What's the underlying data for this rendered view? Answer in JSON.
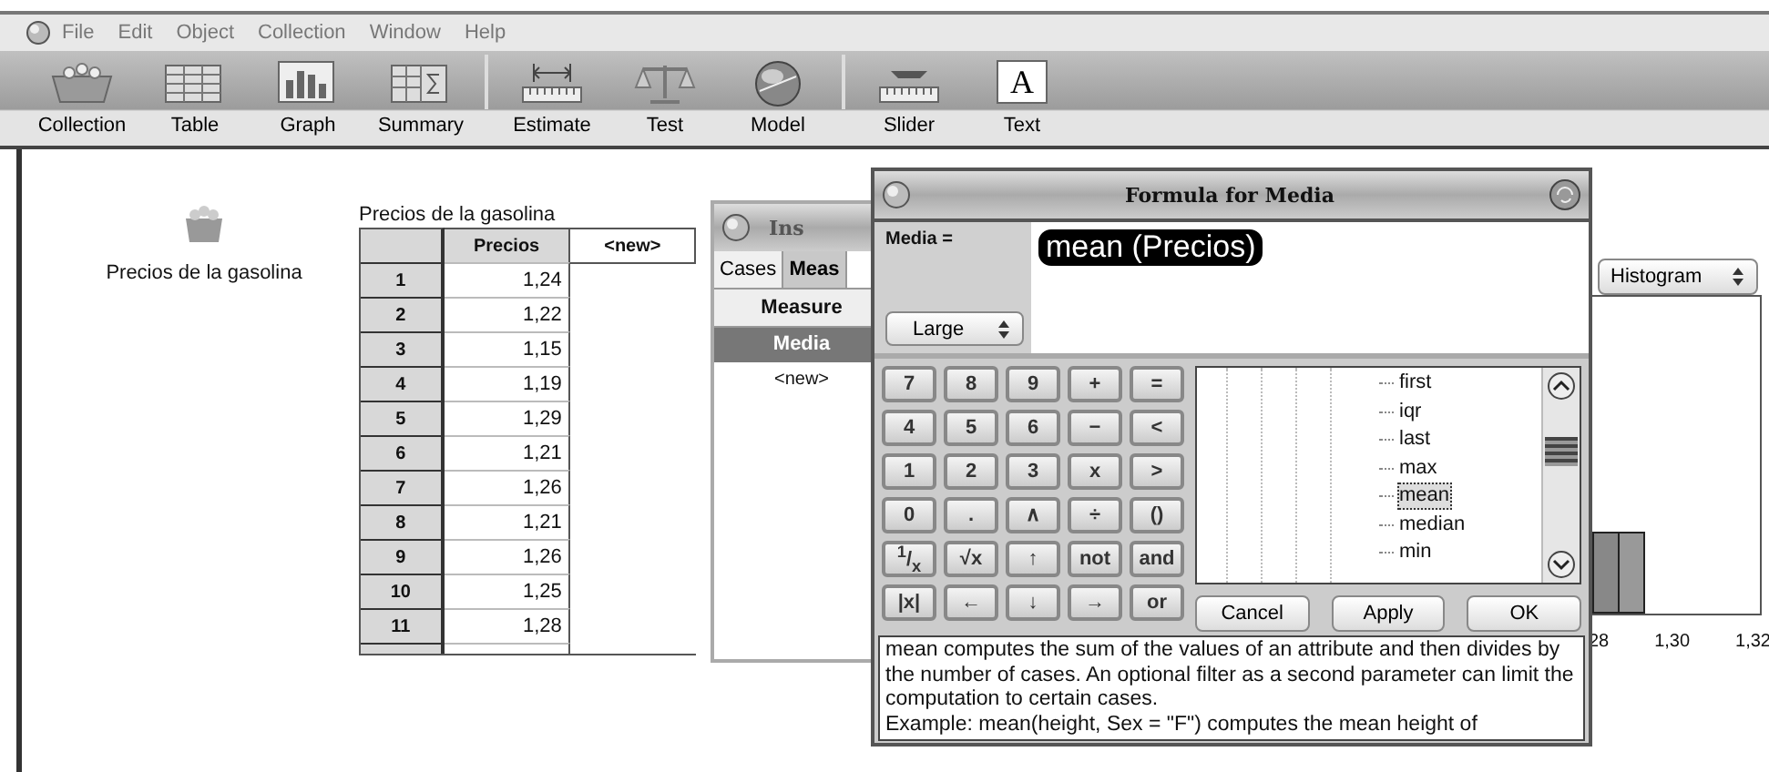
{
  "menu_bar": {
    "items": [
      "File",
      "Edit",
      "Object",
      "Collection",
      "Window",
      "Help"
    ]
  },
  "toolbar": {
    "tools": [
      {
        "label": "Collection",
        "kind": "collection"
      },
      {
        "label": "Table",
        "kind": "table"
      },
      {
        "label": "Graph",
        "kind": "graph"
      },
      {
        "label": "Summary",
        "kind": "summary",
        "separator_after": true
      },
      {
        "label": "Estimate",
        "kind": "estimate"
      },
      {
        "label": "Test",
        "kind": "test"
      },
      {
        "label": "Model",
        "kind": "model",
        "separator_after": true
      },
      {
        "label": "Slider",
        "kind": "slider"
      },
      {
        "label": "Text",
        "kind": "text",
        "glyph": "A"
      }
    ]
  },
  "collection": {
    "label": "Precios de la gasolina"
  },
  "table": {
    "title": "Precios de la gasolina",
    "columns": [
      "Precios",
      "<new>"
    ],
    "rows": [
      {
        "index": "1",
        "value": "1,24"
      },
      {
        "index": "2",
        "value": "1,22"
      },
      {
        "index": "3",
        "value": "1,15"
      },
      {
        "index": "4",
        "value": "1,19"
      },
      {
        "index": "5",
        "value": "1,29"
      },
      {
        "index": "6",
        "value": "1,21"
      },
      {
        "index": "7",
        "value": "1,26"
      },
      {
        "index": "8",
        "value": "1,21"
      },
      {
        "index": "9",
        "value": "1,26"
      },
      {
        "index": "10",
        "value": "1,25"
      },
      {
        "index": "11",
        "value": "1,28"
      }
    ]
  },
  "inspector": {
    "title": "Ins",
    "tabs": [
      {
        "label": "Cases",
        "selected": false
      },
      {
        "label": "Meas",
        "selected": true
      }
    ],
    "column": "Measure",
    "rows": [
      {
        "label": "Media",
        "selected": true
      },
      {
        "label": "<new>",
        "selected": false
      }
    ]
  },
  "graph": {
    "plot_type": "Histogram",
    "axis_labels": [
      "28",
      "1,30",
      "1,32"
    ]
  },
  "formula_editor": {
    "title": "Formula for Media",
    "name_label": "Media =",
    "formula": "mean (Precios)",
    "size": "Large",
    "keys": [
      [
        "7",
        "8",
        "9",
        "+",
        "="
      ],
      [
        "4",
        "5",
        "6",
        "−",
        "<"
      ],
      [
        "1",
        "2",
        "3",
        "x",
        ">"
      ],
      [
        "0",
        ".",
        "∧",
        "÷",
        "()"
      ],
      [
        "$^{1}$/$_{x}$",
        "√x",
        "↑",
        "not",
        "and"
      ],
      [
        "|x|",
        "←",
        "↓",
        "→",
        "or"
      ]
    ],
    "functions": [
      {
        "label": "first",
        "selected": false
      },
      {
        "label": "iqr",
        "selected": false
      },
      {
        "label": "last",
        "selected": false
      },
      {
        "label": "max",
        "selected": false
      },
      {
        "label": "mean",
        "selected": true
      },
      {
        "label": "median",
        "selected": false
      },
      {
        "label": "min",
        "selected": false
      }
    ],
    "buttons": [
      "Cancel",
      "Apply",
      "OK"
    ],
    "description": [
      "mean computes the sum of the values of an attribute and then divides by the number of cases. An optional filter as a second parameter can limit the computation to certain cases.",
      "Example: mean(height, Sex = \"F\") computes the mean height of"
    ]
  }
}
